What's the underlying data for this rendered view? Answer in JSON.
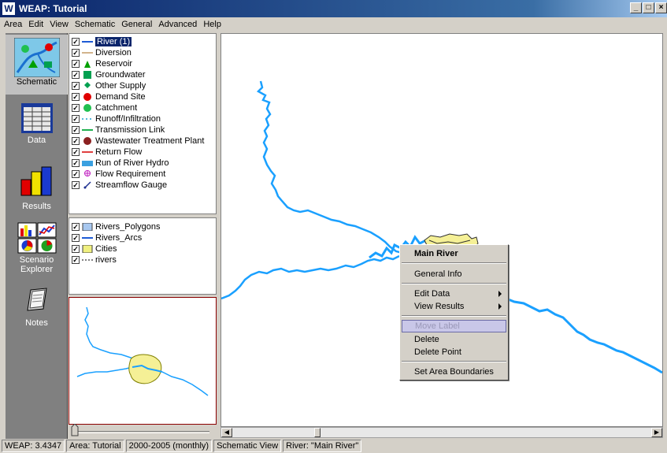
{
  "window": {
    "title": "WEAP: Tutorial",
    "app_icon_letter": "W",
    "min": "_",
    "max": "□",
    "close": "×"
  },
  "menu": [
    "Area",
    "Edit",
    "View",
    "Schematic",
    "General",
    "Advanced",
    "Help"
  ],
  "sidebar": [
    {
      "label": "Schematic",
      "icon": "schematic-icon",
      "active": true
    },
    {
      "label": "Data",
      "icon": "data-icon"
    },
    {
      "label": "Results",
      "icon": "results-icon"
    },
    {
      "label": "Scenario",
      "label2": "Explorer",
      "icon": "scenario-explorer-icon"
    },
    {
      "label": "Notes",
      "icon": "notes-icon"
    }
  ],
  "legend": [
    {
      "label": "River (1)",
      "symbol": "line",
      "color": "#1e5bd6",
      "selected": true
    },
    {
      "label": "Diversion",
      "symbol": "line",
      "color": "#d2b48c"
    },
    {
      "label": "Reservoir",
      "symbol": "triangle",
      "color": "#00a000"
    },
    {
      "label": "Groundwater",
      "symbol": "square",
      "color": "#00a050"
    },
    {
      "label": "Other Supply",
      "symbol": "diamond",
      "color": "#00a050"
    },
    {
      "label": "Demand Site",
      "symbol": "circle",
      "color": "#e00000"
    },
    {
      "label": "Catchment",
      "symbol": "circle",
      "color": "#20c050"
    },
    {
      "label": "Runoff/Infiltration",
      "symbol": "dashed",
      "color": "#20a0d0"
    },
    {
      "label": "Transmission Link",
      "symbol": "line",
      "color": "#20b050"
    },
    {
      "label": "Wastewater Treatment Plant",
      "symbol": "circle",
      "color": "#8b2020"
    },
    {
      "label": "Return Flow",
      "symbol": "line",
      "color": "#e04040"
    },
    {
      "label": "Run of River Hydro",
      "symbol": "rect",
      "color": "#3aa0e0"
    },
    {
      "label": "Flow Requirement",
      "symbol": "target",
      "color": "#c020c0"
    },
    {
      "label": "Streamflow Gauge",
      "symbol": "gauge",
      "color": "#1e3090"
    }
  ],
  "layers": [
    {
      "label": "Rivers_Polygons",
      "symbol": "poly",
      "color": "#a8c8f0"
    },
    {
      "label": "Rivers_Arcs",
      "symbol": "line",
      "color": "#1e5bd6"
    },
    {
      "label": "Cities",
      "symbol": "poly",
      "color": "#f0f080"
    },
    {
      "label": "rivers",
      "symbol": "dashed",
      "color": "#000000"
    }
  ],
  "context_menu": {
    "title": "Main River",
    "general_info": "General Info",
    "edit_data": "Edit Data",
    "view_results": "View Results",
    "move_label": "Move Label",
    "delete": "Delete",
    "delete_point": "Delete Point",
    "set_area_boundaries": "Set Area Boundaries"
  },
  "status": {
    "version": "WEAP: 3.4347",
    "area": "Area: Tutorial",
    "period": "2000-2005 (monthly)",
    "view": "Schematic View",
    "selection": "River: \"Main River\""
  },
  "colors": {
    "river": "#1aa0ff",
    "city": "#f5f096",
    "titlebar": "#0a246a",
    "selection": "#0a246a"
  }
}
